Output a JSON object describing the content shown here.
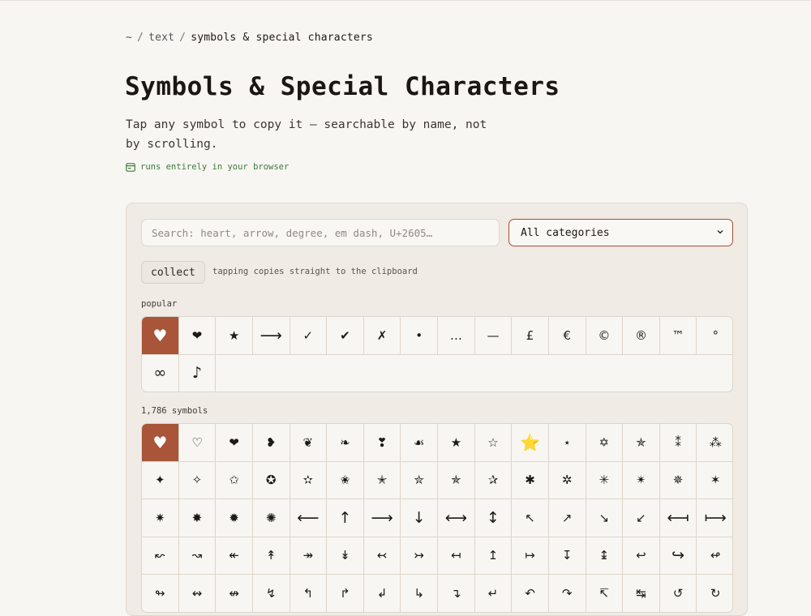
{
  "breadcrumb": {
    "home": "~",
    "sep1": "/",
    "section": "text",
    "sep2": "/",
    "current": "symbols & special characters"
  },
  "page": {
    "title": "Symbols & Special Characters",
    "subtitle": "Tap any symbol to copy it — searchable by name, not by scrolling.",
    "badge": "runs entirely in your browser"
  },
  "search": {
    "placeholder": "Search: heart, arrow, degree, em dash, U+2605…",
    "value": ""
  },
  "category": {
    "selected": "All categories"
  },
  "collect": {
    "label": "collect",
    "hint": "tapping copies straight to the clipboard"
  },
  "popular": {
    "label": "popular",
    "symbols": [
      "♥",
      "❤",
      "★",
      "⟶",
      "✓",
      "✔",
      "✗",
      "•",
      "…",
      "—",
      "£",
      "€",
      "©",
      "®",
      "™",
      "°",
      "∞",
      "♪"
    ]
  },
  "all": {
    "count_label": "1,786 symbols",
    "symbols": [
      "♥",
      "♡",
      "❤",
      "❥",
      "❦",
      "❧",
      "❣",
      "☙",
      "★",
      "☆",
      "⭐",
      "⋆",
      "✡",
      "✯",
      "⁑",
      "⁂",
      "✦",
      "✧",
      "✩",
      "✪",
      "✫",
      "✬",
      "✭",
      "✮",
      "✯",
      "✰",
      "✱",
      "✲",
      "✳",
      "✴",
      "✵",
      "✶",
      "✷",
      "✸",
      "✹",
      "✺",
      "⟵",
      "↑",
      "⟶",
      "↓",
      "⟷",
      "↕",
      "↖",
      "↗",
      "↘",
      "↙",
      "⟻",
      "⟼",
      "↜",
      "↝",
      "↞",
      "↟",
      "↠",
      "↡",
      "↢",
      "↣",
      "↤",
      "↥",
      "↦",
      "↧",
      "↨",
      "↩",
      "↪",
      "↫",
      "↬",
      "↭",
      "↮",
      "↯",
      "↰",
      "↱",
      "↲",
      "↳",
      "↴",
      "↵",
      "↶",
      "↷",
      "↸",
      "↹",
      "↺",
      "↻"
    ]
  },
  "colors": {
    "accent": "#a9553a",
    "select_border": "#a94c31",
    "badge_green": "#3a7a3f",
    "background": "#f8f6f2",
    "panel": "#f0ebe5"
  }
}
